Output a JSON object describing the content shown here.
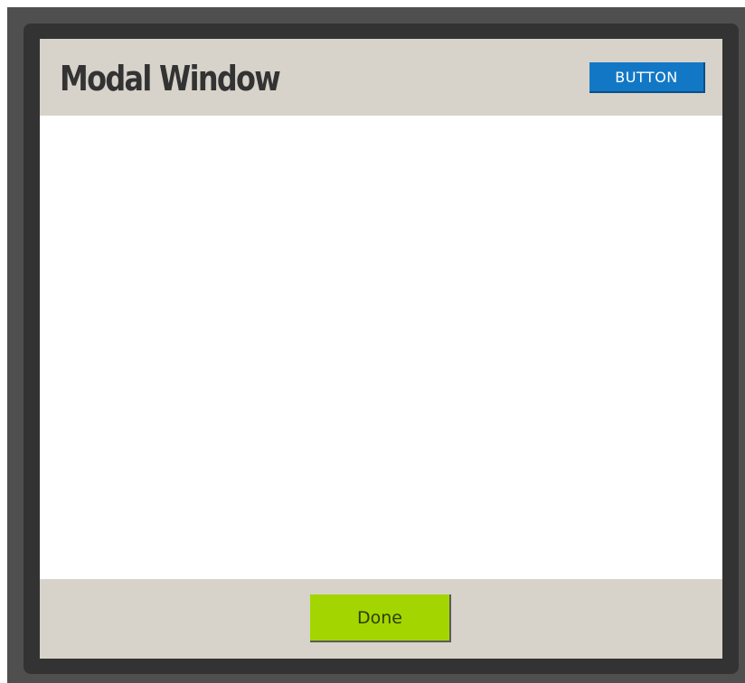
{
  "modal": {
    "title": "Modal Window",
    "header_button_label": "BUTTON",
    "footer": {
      "done_label": "Done"
    }
  },
  "colors": {
    "backdrop": "#4f4f4f",
    "frame": "#333333",
    "header_footer_bg": "#d7d3ca",
    "primary_button": "#1278c6",
    "done_button": "#a3d600"
  }
}
